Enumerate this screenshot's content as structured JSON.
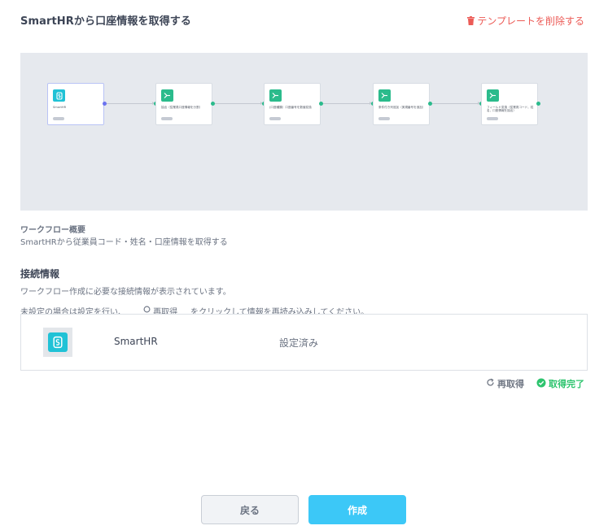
{
  "header": {
    "title": "SmartHRから口座情報を取得する",
    "delete_label": "テンプレートを削除する",
    "delete_icon": "trash-icon",
    "delete_color": "#ec5b56"
  },
  "workflow": {
    "nodes": [
      {
        "label": "SmartHR",
        "icon": "smarthr-logo-icon"
      },
      {
        "label": "抽出（従業員口座情報を分割）",
        "icon": "process-icon"
      },
      {
        "label": "(口座種類）口座番号を数値変換",
        "icon": "process-icon"
      },
      {
        "label": "条件付き列追加（実現番号を追加）",
        "icon": "process-icon"
      },
      {
        "label": "フィールド変換（従業員コード，姓名，口座情報を抽出）",
        "icon": "process-icon"
      }
    ]
  },
  "overview": {
    "heading": "ワークフロー概要",
    "text": "SmartHRから従業員コード・姓名・口座情報を取得する"
  },
  "connection": {
    "heading": "接続情報",
    "desc1": "ワークフロー作成に必要な接続情報が表示されています。",
    "desc2_pre": "未設定の場合は設定を行い、",
    "desc2_refetch": "再取得",
    "desc2_post": "をクリックして情報を再読み込みしてください。",
    "service_name": "SmartHR",
    "service_status": "設定済み",
    "service_icon": "smarthr-logo-icon"
  },
  "status": {
    "refetch_label": "再取得",
    "done_label": "取得完了",
    "done_color": "#2dc46e"
  },
  "footer": {
    "back_label": "戻る",
    "create_label": "作成",
    "create_color": "#3cc8f7"
  }
}
